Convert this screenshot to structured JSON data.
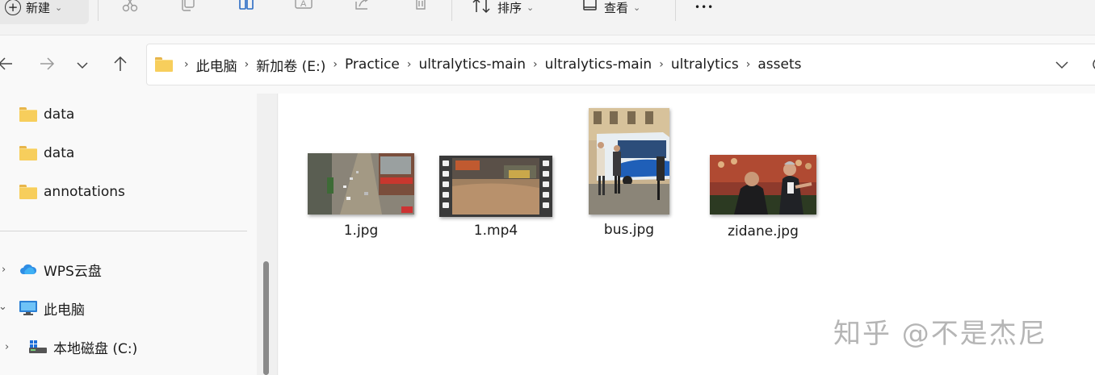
{
  "toolbar": {
    "new_label": "新建",
    "sort_label": "排序",
    "view_label": "查看",
    "more_label": "•••"
  },
  "address": {
    "breadcrumbs": [
      "此电脑",
      "新加卷 (E:)",
      "Practice",
      "ultralytics-main",
      "ultralytics-main",
      "ultralytics",
      "assets"
    ]
  },
  "sidebar": {
    "items": [
      {
        "label": "data",
        "icon": "folder-icon"
      },
      {
        "label": "data",
        "icon": "folder-icon"
      },
      {
        "label": "annotations",
        "icon": "folder-icon"
      },
      {
        "label": "WPS云盘",
        "icon": "cloud-icon"
      },
      {
        "label": "此电脑",
        "icon": "monitor-icon"
      },
      {
        "label": "本地磁盘 (C:)",
        "icon": "drive-icon"
      }
    ]
  },
  "files": [
    {
      "name": "1.jpg",
      "type": "image"
    },
    {
      "name": "1.mp4",
      "type": "video"
    },
    {
      "name": "bus.jpg",
      "type": "image"
    },
    {
      "name": "zidane.jpg",
      "type": "image"
    }
  ],
  "watermark": "知乎 @不是杰尼",
  "colors": {
    "folder": "#f7ce5c",
    "accent": "#0067c0"
  }
}
